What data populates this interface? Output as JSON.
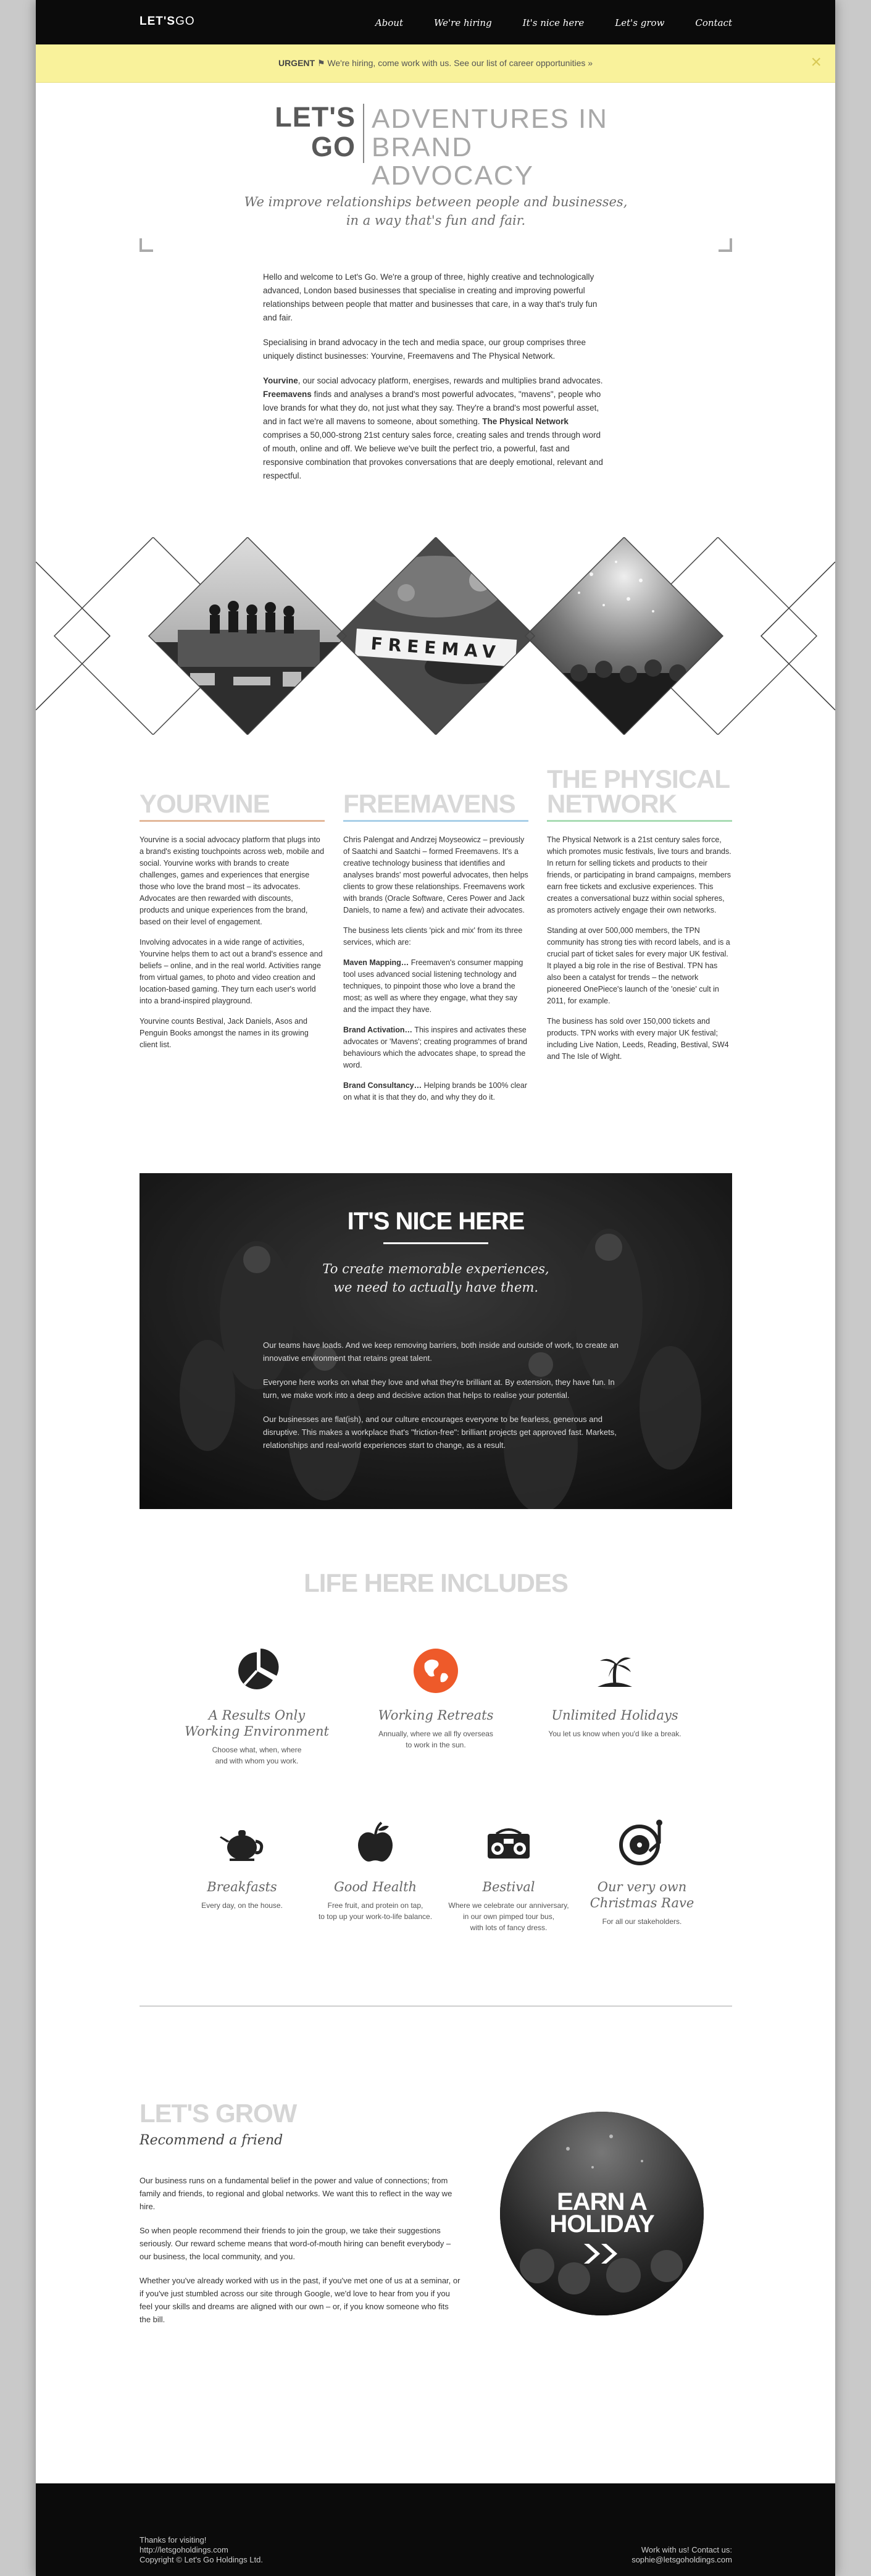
{
  "nav": {
    "logo_bold": "LET'S",
    "logo_rest": "GO",
    "items": [
      "About",
      "We're hiring",
      "It's nice here",
      "Let's grow",
      "Contact"
    ]
  },
  "banner": {
    "strong": "URGENT",
    "flag": "⚑",
    "text": "We're hiring, come work with us. See our list of career opportunities »",
    "close": "×"
  },
  "header": {
    "logo_line1": "LET'S",
    "logo_line2": "GO",
    "title_line1": "ADVENTURES IN",
    "title_line2": "BRAND ADVOCACY",
    "tagline_line1": "We improve relationships between people and businesses,",
    "tagline_line2": "in a way that's fun and fair."
  },
  "intro": {
    "p1": "Hello and welcome to Let's Go. We're a group of three, highly creative and technologically advanced, London based businesses that specialise in creating and improving powerful relationships between people that matter and businesses that care, in a way that's truly fun and fair.",
    "p2": "Specialising in brand advocacy in the tech and media space, our group comprises three uniquely distinct businesses: Yourvine, Freemavens and The Physical Network.",
    "p3_b1": "Yourvine",
    "p3_t1": ", our social advocacy platform, energises, rewards and multiplies brand advocates. ",
    "p3_b2": "Freemavens",
    "p3_t2": " finds and analyses a brand's most powerful advocates, \"mavens\", people who love brands for what they do, not just what they say. They're a brand's most powerful asset, and in fact we're all mavens to someone, about something. ",
    "p3_b3": "The Physical Network",
    "p3_t3": " comprises a 50,000-strong 21st century sales force, creating sales and trends through word of mouth, online and off. We believe we've built the perfect trio, a powerful, fast and responsive combination that provokes conversations that are deeply emotional, relevant and respectful.",
    "scrabble_word": "FREEMAV"
  },
  "columns": {
    "yourvine": {
      "title": "YOURVINE",
      "color": "#e3b89a",
      "p1": "Yourvine is a social advocacy platform that plugs into a brand's existing touchpoints across web, mobile and social. Yourvine works with brands to create challenges, games and experiences that energise those who love the brand most – its advocates. Advocates are then rewarded with discounts, products and unique experiences from the brand, based on their level of engagement.",
      "p2": "Involving advocates in a wide range of activities, Yourvine helps them to act out a brand's essence and beliefs – online, and in the real world. Activities range from virtual games, to photo and video creation and location-based gaming. They turn each user's world into a brand-inspired playground.",
      "p3": "Yourvine counts Bestival, Jack Daniels, Asos and Penguin Books amongst the names in its growing client list."
    },
    "freemavens": {
      "title": "FREEMAVENS",
      "color": "#a9cfe8",
      "p1": "Chris Palengat and Andrzej Moyseowicz – previously of Saatchi and Saatchi – formed Freemavens. It's a creative technology business that identifies and analyses brands' most powerful advocates, then helps clients to grow these relationships. Freemavens work with brands (Oracle Software, Ceres Power and Jack Daniels, to name a few) and activate their advocates.",
      "p2": "The business lets clients 'pick and mix' from its three services, which are:",
      "p3_b": "Maven Mapping…",
      "p3_t": " Freemaven's consumer mapping tool uses advanced social listening technology and techniques, to pinpoint those who love a brand the most; as well as where they engage, what they say and the impact they have.",
      "p4_b": "Brand Activation…",
      "p4_t": " This inspires and activates these advocates or 'Mavens'; creating programmes of brand behaviours which the advocates shape, to spread the word.",
      "p5_b": "Brand Consultancy…",
      "p5_t": " Helping brands be 100% clear on what it is that they do, and why they do it."
    },
    "physical": {
      "title_line1": "THE PHYSICAL",
      "title_line2": "NETWORK",
      "color": "#a9dcb4",
      "p1": "The Physical Network is a 21st century sales force, which promotes music festivals, live tours and brands. In return for selling tickets and products to their friends, or participating in brand campaigns, members earn free tickets and exclusive experiences. This creates a conversational buzz within social spheres, as promoters actively engage their own networks.",
      "p2": "Standing at over 500,000 members, the TPN community has strong ties with record labels, and is a crucial part of ticket sales for every major UK festival. It played a big role in the rise of Bestival. TPN has also been a catalyst for trends – the network pioneered OnePiece's launch of the 'onesie' cult in 2011, for example.",
      "p3": "The business has sold over 150,000 tickets and products. TPN works with every major UK festival; including Live Nation, Leeds, Reading, Bestival, SW4 and The Isle of Wight."
    }
  },
  "nice": {
    "title": "IT'S NICE HERE",
    "sub_line1": "To create memorable experiences,",
    "sub_line2": "we need to actually have them.",
    "p1": "Our teams have loads. And we keep removing barriers, both inside and outside of work, to create an innovative environment that retains great talent.",
    "p2": "Everyone here works on what they love and what they're brilliant at. By extension, they have fun. In turn, we make work into a deep and decisive action that helps to realise your potential.",
    "p3": "Our businesses are flat(ish), and our culture encourages everyone to be fearless, generous and disruptive. This makes a workplace that's \"friction-free\": brilliant projects get approved fast. Markets, relationships and real-world experiences start to change, as a result."
  },
  "life": {
    "title": "LIFE HERE INCLUDES",
    "accent": "#ee5a2a",
    "perks": [
      {
        "icon": "pie-chart-icon",
        "title_line1": "A Results Only",
        "title_line2": "Working Environment",
        "desc_line1": "Choose what, when, where",
        "desc_line2": "and with whom you work."
      },
      {
        "icon": "globe-icon",
        "title_line1": "Working Retreats",
        "title_line2": "",
        "desc_line1": "Annually, where we all fly overseas",
        "desc_line2": "to work in the sun."
      },
      {
        "icon": "palm-island-icon",
        "title_line1": "Unlimited Holidays",
        "title_line2": "",
        "desc_line1": "You let us know when you'd like a break.",
        "desc_line2": ""
      },
      {
        "icon": "teapot-icon",
        "title_line1": "Breakfasts",
        "title_line2": "",
        "desc_line1": "Every day, on the house.",
        "desc_line2": ""
      },
      {
        "icon": "apple-icon",
        "title_line1": "Good Health",
        "title_line2": "",
        "desc_line1": "Free fruit, and protein on tap,",
        "desc_line2": "to top up your work-to-life balance."
      },
      {
        "icon": "boombox-icon",
        "title_line1": "Bestival",
        "title_line2": "",
        "desc_line1": "Where we celebrate our anniversary,",
        "desc_line2": "in our own pimped tour bus,",
        "desc_line3": "with lots of fancy dress."
      },
      {
        "icon": "turntable-icon",
        "title_line1": "Our very own",
        "title_line2": "Christmas Rave",
        "desc_line1": "For all our stakeholders.",
        "desc_line2": ""
      }
    ]
  },
  "grow": {
    "title": "LET'S GROW",
    "sub": "Recommend a friend",
    "p1": "Our business runs on a fundamental belief in the power and value of connections; from family and friends, to regional and global networks. We want this to reflect in the way we hire.",
    "p2": "So when people recommend their friends to join the group, we take their suggestions seriously. Our reward scheme means that word-of-mouth hiring can benefit everybody – our business, the local community, and you.",
    "p3": "Whether you've already worked with us in the past, if you've met one of us at a seminar, or if you've just stumbled across our site through Google, we'd love to hear from you if you feel your skills and dreams are aligned with our own – or, if you know someone who fits the bill.",
    "earn_line1": "EARN A",
    "earn_line2": "HOLIDAY",
    "arrows": "»"
  },
  "footer": {
    "line1": "Thanks for visiting!",
    "line2": "http://letsgoholdings.com",
    "line3": "Copyright © Let's Go Holdings Ltd.",
    "r1": "Work with us! Contact us:",
    "r2": "sophie@letsgoholdings.com"
  }
}
